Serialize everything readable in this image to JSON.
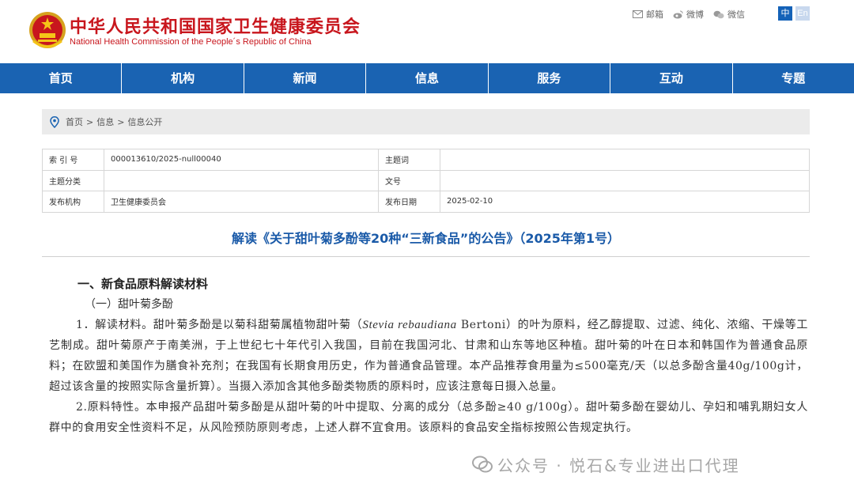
{
  "header": {
    "site_name_cn": "中华人民共和国国家卫生健康委员会",
    "site_name_en": "National Health Commission of the People´s Republic of China",
    "links": [
      {
        "icon": "mail-icon",
        "label": "邮箱"
      },
      {
        "icon": "weibo-icon",
        "label": "微博"
      },
      {
        "icon": "wechat-icon",
        "label": "微信"
      }
    ],
    "lang_zh": "中",
    "lang_en": "En"
  },
  "nav": {
    "items": [
      "首页",
      "机构",
      "新闻",
      "信息",
      "服务",
      "互动",
      "专题"
    ]
  },
  "breadcrumb": {
    "items": [
      "首页",
      "信息",
      "信息公开"
    ],
    "separator": ">"
  },
  "info": {
    "rows": [
      {
        "l1": "索 引 号",
        "v1": "000013610/2025-null00040",
        "l2": "主题词",
        "v2": ""
      },
      {
        "l1": "主题分类",
        "v1": "",
        "l2": "文号",
        "v2": ""
      },
      {
        "l1": "发布机构",
        "v1": "卫生健康委员会",
        "l2": "发布日期",
        "v2": "2025-02-10"
      }
    ]
  },
  "article": {
    "title": "解读《关于甜叶菊多酚等20种“三新食品”的公告》（2025年第1号）",
    "heading1": "一、新食品原料解读材料",
    "heading2": "（一）甜叶菊多酚",
    "p1_lead": "1．解读材料。甜叶菊多酚是以菊科甜菊属植物甜叶菊（",
    "p1_latin": "Stevia rebaudiana",
    "p1_rest": " Bertoni）的叶为原料，经乙醇提取、过滤、纯化、浓缩、干燥等工艺制成。甜叶菊原产于南美洲，于上世纪七十年代引入我国，目前在我国河北、甘肃和山东等地区种植。甜叶菊的叶在日本和韩国作为普通食品原料；在欧盟和美国作为膳食补充剂；在我国有长期食用历史，作为普通食品管理。本产品推荐食用量为≤500毫克/天（以总多酚含量40g/100g计，超过该含量的按照实际含量折算）。当摄入添加含其他多酚类物质的原料时，应该注意每日摄入总量。",
    "p2": "2.原料特性。本申报产品甜叶菊多酚是从甜叶菊的叶中提取、分离的成分（总多酚≥40 g/100g）。甜叶菊多酚在婴幼儿、孕妇和哺乳期妇女人群中的食用安全性资料不足，从风险预防原则考虑，上述人群不宜食用。该原料的食品安全指标按照公告规定执行。"
  },
  "watermark": {
    "text": "公众号 · 悦石&专业进出口代理"
  },
  "colors": {
    "brand_red": "#c8161d",
    "nav_blue": "#1a63b2",
    "title_blue": "#1a5aa8"
  }
}
